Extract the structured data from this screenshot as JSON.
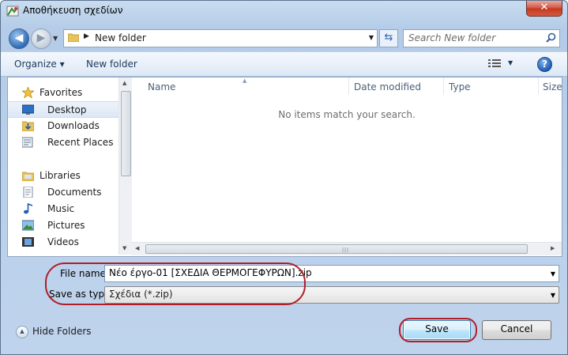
{
  "window": {
    "title": "Αποθήκευση σχεδίων",
    "close_glyph": "✕"
  },
  "address_bar": {
    "breadcrumb": "New folder",
    "separator": "▶",
    "dropdown_glyph": "▼"
  },
  "navigation": {
    "back_glyph": "◀",
    "forward_glyph": "▶",
    "history_glyph": "▼",
    "refresh_glyph": "⇆"
  },
  "search": {
    "placeholder": "Search New folder"
  },
  "toolbar": {
    "organize": "Organize ▾",
    "new_folder": "New folder",
    "view_drop": "▼",
    "help": "?"
  },
  "sidebar": {
    "favorites": {
      "label": "Favorites",
      "items": [
        {
          "label": "Desktop",
          "selected": true
        },
        {
          "label": "Downloads"
        },
        {
          "label": "Recent Places"
        }
      ]
    },
    "libraries": {
      "label": "Libraries",
      "items": [
        {
          "label": "Documents"
        },
        {
          "label": "Music"
        },
        {
          "label": "Pictures"
        },
        {
          "label": "Videos"
        }
      ]
    }
  },
  "file_list": {
    "columns": [
      "Name",
      "Date modified",
      "Type",
      "Size"
    ],
    "empty_message": "No items match your search."
  },
  "form": {
    "file_name_label": "File name:",
    "file_name_value": "Νέο έργο-01 [ΣΧΕΔΙΑ ΘΕΡΜΟΓΕΦΥΡΩΝ].zip",
    "save_as_type_label": "Save as type:",
    "save_as_type_value": "Σχέδια (*.zip)",
    "dropdown_glyph": "▼"
  },
  "footer": {
    "hide_folders": "Hide Folders",
    "save": "Save",
    "cancel": "Cancel"
  },
  "colors": {
    "highlight_red": "#b01e28",
    "frame_blue": "#b4cce8",
    "link_blue": "#1e395b"
  }
}
